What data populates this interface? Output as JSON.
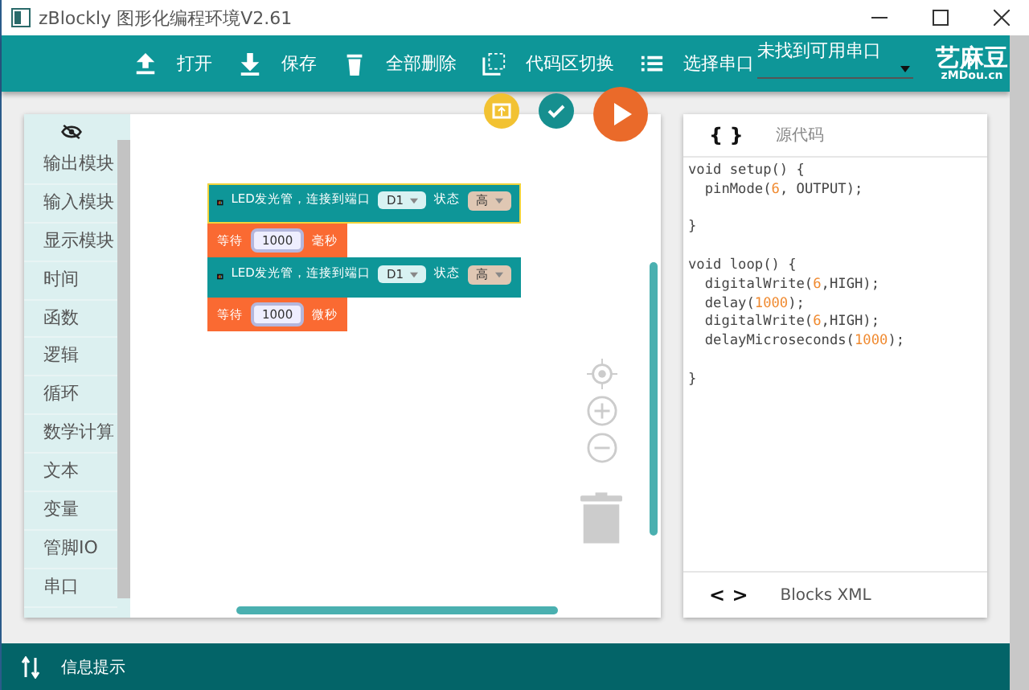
{
  "window": {
    "title": "zBlockly 图形化编程环境V2.61"
  },
  "toolbar": {
    "buttons": [
      {
        "kind": "upload",
        "label": "打开"
      },
      {
        "kind": "download",
        "label": "保存"
      },
      {
        "kind": "trash",
        "label": "全部删除"
      },
      {
        "kind": "switch",
        "label": "代码区切换"
      },
      {
        "kind": "list",
        "label": "选择串口"
      }
    ],
    "port_select": {
      "value": "未找到可用串口"
    },
    "logo": {
      "title": "艺麻豆",
      "subtitle": "zMDou.cn"
    }
  },
  "categories": [
    "输出模块",
    "输入模块",
    "显示模块",
    "时间",
    "函数",
    "逻辑",
    "循环",
    "数学计算",
    "文本",
    "变量",
    "管脚IO",
    "串口"
  ],
  "blocks": [
    {
      "kind": "led",
      "selected": true,
      "label": "LED发光管，连接到端口",
      "pin": "D1",
      "state_label": "状态",
      "state": "高"
    },
    {
      "kind": "wait",
      "selected": false,
      "label": "等待",
      "value": "1000",
      "unit": "毫秒"
    },
    {
      "kind": "led",
      "selected": false,
      "label": "LED发光管，连接到端口",
      "pin": "D1",
      "state_label": "状态",
      "state": "高"
    },
    {
      "kind": "wait",
      "selected": false,
      "label": "等待",
      "value": "1000",
      "unit": "微秒"
    }
  ],
  "code_panel": {
    "tab_icon": "{ }",
    "title": "源代码",
    "lines": [
      {
        "kind": "code",
        "parts": [
          {
            "kind": "text",
            "text": "void setup() {"
          }
        ]
      },
      {
        "kind": "code",
        "parts": [
          {
            "kind": "text",
            "text": "  pinMode("
          },
          {
            "kind": "num",
            "text": "6"
          },
          {
            "kind": "text",
            "text": ", OUTPUT);"
          }
        ]
      },
      {
        "kind": "blank"
      },
      {
        "kind": "code",
        "parts": [
          {
            "kind": "text",
            "text": "}"
          }
        ]
      },
      {
        "kind": "blank"
      },
      {
        "kind": "code",
        "parts": [
          {
            "kind": "text",
            "text": "void loop() {"
          }
        ]
      },
      {
        "kind": "code",
        "parts": [
          {
            "kind": "text",
            "text": "  digitalWrite("
          },
          {
            "kind": "num",
            "text": "6"
          },
          {
            "kind": "text",
            "text": ",HIGH);"
          }
        ]
      },
      {
        "kind": "code",
        "parts": [
          {
            "kind": "text",
            "text": "  delay("
          },
          {
            "kind": "num",
            "text": "1000"
          },
          {
            "kind": "text",
            "text": ");"
          }
        ]
      },
      {
        "kind": "code",
        "parts": [
          {
            "kind": "text",
            "text": "  digitalWrite("
          },
          {
            "kind": "num",
            "text": "6"
          },
          {
            "kind": "text",
            "text": ",HIGH);"
          }
        ]
      },
      {
        "kind": "code",
        "parts": [
          {
            "kind": "text",
            "text": "  delayMicroseconds("
          },
          {
            "kind": "num",
            "text": "1000"
          },
          {
            "kind": "text",
            "text": ");"
          }
        ]
      },
      {
        "kind": "blank"
      },
      {
        "kind": "code",
        "parts": [
          {
            "kind": "text",
            "text": "}"
          }
        ]
      }
    ],
    "footer_icon": "< >",
    "footer_label": "Blocks XML"
  },
  "status_bar": {
    "label": "信息提示"
  }
}
